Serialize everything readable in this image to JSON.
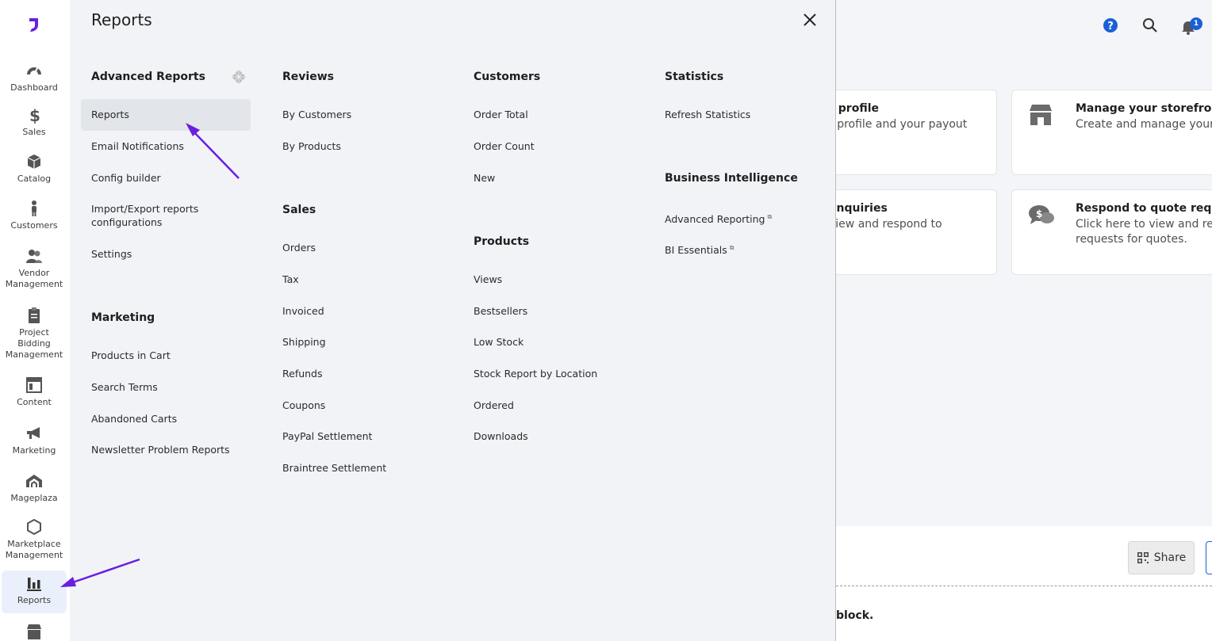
{
  "sidebar": {
    "items": [
      {
        "label": "Dashboard",
        "icon": "dashboard-icon"
      },
      {
        "label": "Sales",
        "icon": "dollar-icon"
      },
      {
        "label": "Catalog",
        "icon": "box-icon"
      },
      {
        "label": "Customers",
        "icon": "person-icon"
      },
      {
        "label": "Vendor Management",
        "icon": "people-icon"
      },
      {
        "label": "Project Bidding Management",
        "icon": "clipboard-icon"
      },
      {
        "label": "Content",
        "icon": "layout-icon"
      },
      {
        "label": "Marketing",
        "icon": "megaphone-icon"
      },
      {
        "label": "Mageplaza",
        "icon": "mageplaza-icon"
      },
      {
        "label": "Marketplace Management",
        "icon": "hexagon-icon"
      },
      {
        "label": "Reports",
        "icon": "bar-chart-icon"
      }
    ]
  },
  "panel": {
    "title": "Reports",
    "columns": {
      "advanced": {
        "title": "Advanced Reports",
        "links": [
          "Reports",
          "Email Notifications",
          "Config builder",
          "Import/Export reports configurations",
          "Settings"
        ]
      },
      "marketing": {
        "title": "Marketing",
        "links": [
          "Products in Cart",
          "Search Terms",
          "Abandoned Carts",
          "Newsletter Problem Reports"
        ]
      },
      "reviews": {
        "title": "Reviews",
        "links": [
          "By Customers",
          "By Products"
        ]
      },
      "sales": {
        "title": "Sales",
        "links": [
          "Orders",
          "Tax",
          "Invoiced",
          "Shipping",
          "Refunds",
          "Coupons",
          "PayPal Settlement",
          "Braintree Settlement"
        ]
      },
      "customers": {
        "title": "Customers",
        "links": [
          "Order Total",
          "Order Count",
          "New"
        ]
      },
      "products": {
        "title": "Products",
        "links": [
          "Views",
          "Bestsellers",
          "Low Stock",
          "Stock Report by Location",
          "Ordered",
          "Downloads"
        ]
      },
      "statistics": {
        "title": "Statistics",
        "links": [
          "Refresh Statistics"
        ]
      },
      "bi": {
        "title": "Business Intelligence",
        "links": [
          "Advanced Reporting",
          "BI Essentials"
        ]
      }
    }
  },
  "background": {
    "notification_count": "1",
    "cards": [
      {
        "title": "r profile",
        "desc": "r profile and your payout"
      },
      {
        "title": "Manage your storefront",
        "desc": "Create and manage your s"
      },
      {
        "title": "enquiries",
        "desc": "view and respond to"
      },
      {
        "title": "Respond to quote reque",
        "desc": "Click here to view and resp",
        "desc2": "requests for quotes."
      }
    ],
    "share_label": "Share",
    "block_text": "block."
  },
  "colors": {
    "accent": "#6a1ee0",
    "help": "#1a5fd6",
    "notification": "#1a5fd6"
  }
}
